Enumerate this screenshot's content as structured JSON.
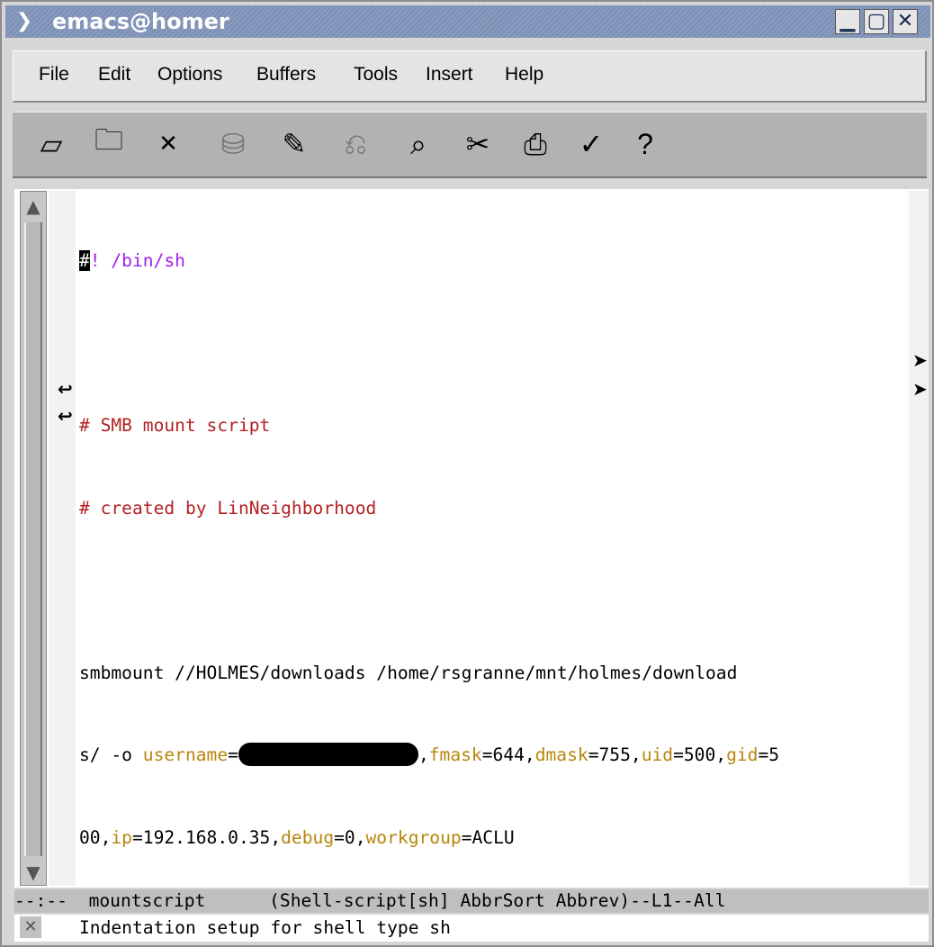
{
  "window": {
    "title": "emacs@homer"
  },
  "menu": {
    "items": [
      "File",
      "Edit",
      "Options",
      "Buffers",
      "Tools",
      "Insert",
      "Help"
    ]
  },
  "toolbar": {
    "buttons": [
      {
        "name": "new-file-icon",
        "glyph": "▱",
        "enabled": true
      },
      {
        "name": "open-folder-icon",
        "glyph": "🗀",
        "enabled": true
      },
      {
        "name": "close-buffer-icon",
        "glyph": "✕",
        "enabled": true
      },
      {
        "name": "save-icon",
        "glyph": "⛁",
        "enabled": false
      },
      {
        "name": "save-as-icon",
        "glyph": "✎",
        "enabled": true
      },
      {
        "name": "undo-icon",
        "glyph": "⎌",
        "enabled": false
      },
      {
        "name": "search-icon",
        "glyph": "⌕",
        "enabled": true
      },
      {
        "name": "cut-icon",
        "glyph": "✂",
        "enabled": true
      },
      {
        "name": "print-icon",
        "glyph": "⎙",
        "enabled": true
      },
      {
        "name": "customize-icon",
        "glyph": "✓",
        "enabled": true
      },
      {
        "name": "help-icon",
        "glyph": "?",
        "enabled": true
      }
    ]
  },
  "buffer": {
    "line1": {
      "cursor_char": "#",
      "rest": "! /bin/sh"
    },
    "line3": "# SMB mount script",
    "line4": "# created by LinNeighborhood",
    "line6": "smbmount //HOLMES/downloads /home/rsgranne/mnt/holmes/download",
    "line7": {
      "p1": "s/ -o ",
      "k_username": "username",
      "eq": "=",
      "p2": ",",
      "k_fmask": "fmask",
      "v_fmask": "=644,",
      "k_dmask": "dmask",
      "v_dmask": "=755,",
      "k_uid": "uid",
      "v_uid": "=500,",
      "k_gid": "gid",
      "v_gid": "=5"
    },
    "line8": {
      "p1": "00,",
      "k_ip": "ip",
      "v_ip": "=192.168.0.35,",
      "k_debug": "debug",
      "v_debug": "=0,",
      "k_workgroup": "workgroup",
      "v_workgroup": "=ACLU"
    }
  },
  "modeline": {
    "text": "--:--  mountscript      (Shell-script[sh] AbbrSort Abbrev)--L1--All"
  },
  "minibuffer": {
    "text": "Indentation setup for shell type sh"
  },
  "colors": {
    "comment": "#b22222",
    "keyword": "#a020f0",
    "variable": "#b8860b",
    "titlebar": "#7c8fb4"
  }
}
